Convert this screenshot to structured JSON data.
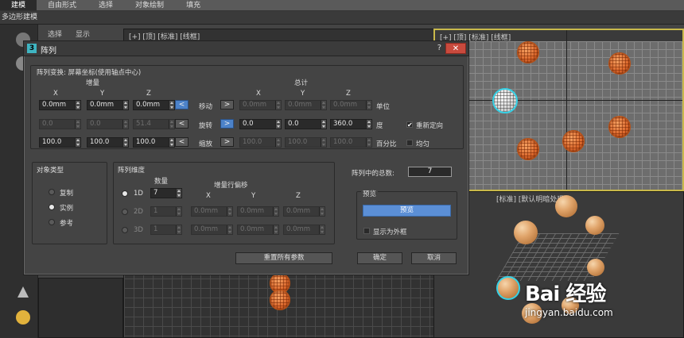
{
  "ribbon": {
    "tabs": [
      "建模",
      "自由形式",
      "选择",
      "对象绘制",
      "填充"
    ],
    "active_index": 0
  },
  "subbar": {
    "label": "多边形建模"
  },
  "command_panel": {
    "tabs": [
      "选择",
      "显示"
    ]
  },
  "viewports": {
    "top_left_label": "[+] [顶] [标准] [线框]",
    "top_right_label": "[+] [顶] [标准] [线框]",
    "bottom_right_label": "[标准] [默认明暗处理]"
  },
  "dialog": {
    "title": "阵列",
    "help": "?",
    "close": "✕",
    "transform": {
      "group_label": "阵列变换: 屏幕坐标(使用轴点中心)",
      "increment_label": "增量",
      "totals_label": "总计",
      "axis_headers": [
        "X",
        "Y",
        "Z"
      ],
      "move": {
        "label": "移动",
        "inc": [
          "0.0mm",
          "0.0mm",
          "0.0mm"
        ],
        "tot": [
          "0.0mm",
          "0.0mm",
          "0.0mm"
        ],
        "unit": "单位"
      },
      "rotate": {
        "label": "旋转",
        "inc": [
          "0.0",
          "0.0",
          "51.4"
        ],
        "tot": [
          "0.0",
          "0.0",
          "360.0"
        ],
        "unit": "度"
      },
      "scale": {
        "label": "缩放",
        "inc": [
          "100.0",
          "100.0",
          "100.0"
        ],
        "tot": [
          "100.0",
          "100.0",
          "100.0"
        ],
        "unit": "百分比"
      },
      "arrow_left": "<",
      "arrow_right": ">",
      "reorient_label": "重新定向",
      "uniform_label": "均匀"
    },
    "object_type": {
      "group_label": "对象类型",
      "options": [
        "复制",
        "实例",
        "参考"
      ],
      "selected": 1
    },
    "array_dims": {
      "group_label": "阵列维度",
      "count_label": "数量",
      "row_offset_label": "增量行偏移",
      "axis_headers": [
        "X",
        "Y",
        "Z"
      ],
      "rows": [
        {
          "label": "1D",
          "count": "7",
          "offsets": []
        },
        {
          "label": "2D",
          "count": "1",
          "offsets": [
            "0.0mm",
            "0.0mm",
            "0.0mm"
          ]
        },
        {
          "label": "3D",
          "count": "1",
          "offsets": [
            "0.0mm",
            "0.0mm",
            "0.0mm"
          ]
        }
      ],
      "selected": 0
    },
    "total_label": "阵列中的总数:",
    "total_value": "7",
    "preview": {
      "group_label": "预览",
      "button": "预览",
      "show_box_label": "显示为外框"
    },
    "reset_button": "重置所有参数",
    "ok_button": "确定",
    "cancel_button": "取消"
  },
  "watermark": {
    "brand": "Bai  经验",
    "url": "jingyan.baidu.com"
  },
  "colors": {
    "accent_blue": "#5b8fd6",
    "close_red": "#c94a3d",
    "wire_orange": "#d9652a",
    "select_cyan": "#35d1e6"
  }
}
